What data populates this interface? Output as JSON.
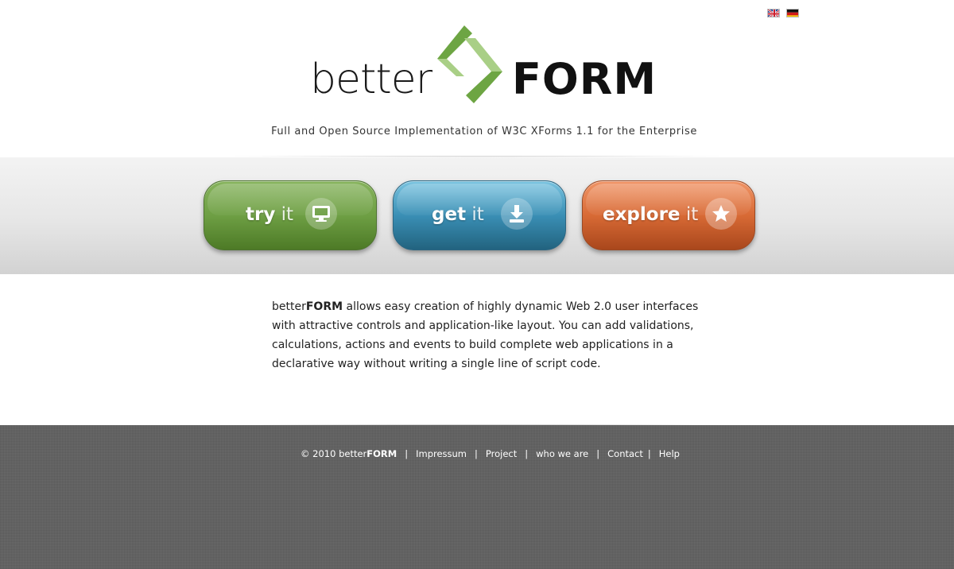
{
  "header": {
    "flags": [
      {
        "name": "english-flag-icon",
        "lang": "en"
      },
      {
        "name": "german-flag-icon",
        "lang": "de"
      }
    ],
    "logo": {
      "text_light": "better",
      "text_bold": "FORM",
      "mark_colors": {
        "dark_green": "#6da543",
        "light_green": "#a9cf86"
      }
    },
    "tagline": "Full and Open Source Implementation of W3C XForms 1.1 for the Enterprise"
  },
  "buttons": {
    "try": {
      "bold": "try",
      "light": "it",
      "icon": "monitor-icon",
      "color": "#6e9f44"
    },
    "get": {
      "bold": "get",
      "light": "it",
      "icon": "download-icon",
      "color": "#3a8fb5"
    },
    "explore": {
      "bold": "explore",
      "light": "it",
      "icon": "star-icon",
      "color": "#d86a35"
    }
  },
  "content": {
    "brand_light": "better",
    "brand_bold": "FORM",
    "text": " allows easy creation of highly dynamic Web 2.0 user interfaces with attractive controls and application-like layout. You can add validations, calculations, actions and events to build complete web applications in a declarative way without writing a single line of script code."
  },
  "footer": {
    "copyright_prefix": "© 2010 better",
    "copyright_bold": "FORM",
    "links": {
      "impressum": "Impressum",
      "project": "Project",
      "who_we_are": "who we are",
      "contact": "Contact",
      "help": "Help"
    },
    "separator": "|"
  }
}
